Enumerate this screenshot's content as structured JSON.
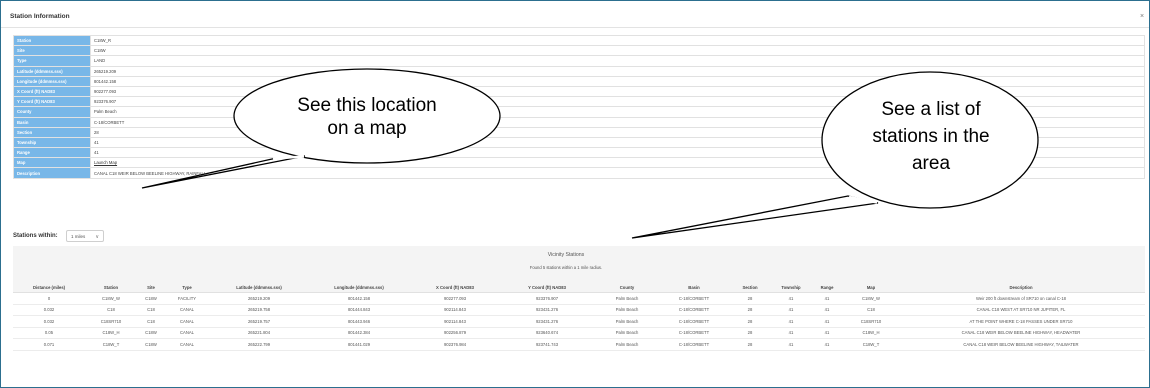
{
  "dialog": {
    "title": "Station Information",
    "close": "×"
  },
  "station_info": [
    {
      "label": "Station",
      "value": "C18W_R"
    },
    {
      "label": "Site",
      "value": "C18W"
    },
    {
      "label": "Type",
      "value": "LAND"
    },
    {
      "label": "Latitude (ddmmss.sss)",
      "value": "265219.209"
    },
    {
      "label": "Longitude (ddmmss.sss)",
      "value": "801442.158"
    },
    {
      "label": "X Coord (ft) NAD83",
      "value": "902277.093"
    },
    {
      "label": "Y Coord (ft) NAD83",
      "value": "923376.907"
    },
    {
      "label": "County",
      "value": "Palm Beach"
    },
    {
      "label": "Basin",
      "value": "C-18/CORBETT"
    },
    {
      "label": "Section",
      "value": "28"
    },
    {
      "label": "Township",
      "value": "41"
    },
    {
      "label": "Range",
      "value": "41"
    },
    {
      "label": "Map",
      "value": "Launch Map"
    },
    {
      "label": "Description",
      "value": "CANAL C18 WEIR BELOW BEELINE HIGHWAY, RAINFALL"
    }
  ],
  "stations_within": {
    "label": "Stations within:",
    "selected": "1 miles"
  },
  "vicinity": {
    "title": "Vicinity Stations",
    "subtitle": "Found 5 stations within a 1 mile radius.",
    "columns": [
      "Distance (miles)",
      "Station",
      "Site",
      "Type",
      "Latitude (ddmmss.sss)",
      "Longitude (ddmmss.sss)",
      "X Coord (ft) NAD83",
      "Y Coord (ft) NAD83",
      "County",
      "Basin",
      "Section",
      "Township",
      "Range",
      "Map",
      "Description"
    ],
    "rows": [
      [
        "0",
        "C18W_W",
        "C18W",
        "FACILITY",
        "265219.209",
        "801442.158",
        "902277.093",
        "923376.907",
        "Palm Beach",
        "C-18/CORBETT",
        "28",
        "41",
        "41",
        "C18W_W",
        "Weir 200 ft downstream of SR710 on canal C-18"
      ],
      [
        "0.032",
        "C18",
        "C18",
        "CANAL",
        "265219.758",
        "801444.843",
        "902114.843",
        "923431.276",
        "Palm Beach",
        "C-18/CORBETT",
        "28",
        "41",
        "41",
        "C18",
        "CANAL C18 WEST AT SR710 NR JUPITER, FL"
      ],
      [
        "0.032",
        "C18SR710",
        "C18",
        "CANAL",
        "265219.757",
        "801443.946",
        "902114.843",
        "923431.276",
        "Palm Beach",
        "C-18/CORBETT",
        "28",
        "41",
        "41",
        "C18SR710",
        "AT THE POINT WHERE C-18 PASSES UNDER SR710"
      ],
      [
        "0.05",
        "C18W_H",
        "C18W",
        "CANAL",
        "265221.804",
        "801442.384",
        "902256.879",
        "923640.674",
        "Palm Beach",
        "C-18/CORBETT",
        "28",
        "41",
        "41",
        "C18W_H",
        "CANAL C18 WEIR BELOW BEELINE HIGHWAY, HEADWATER"
      ],
      [
        "0.071",
        "C18W_T",
        "C18W",
        "CANAL",
        "265222.799",
        "801441.029",
        "902376.984",
        "923741.743",
        "Palm Beach",
        "C-18/CORBETT",
        "28",
        "41",
        "41",
        "C18W_T",
        "CANAL C18 WEIR BELOW BEELINE HIGHWAY, TAILWATER"
      ]
    ]
  },
  "callouts": {
    "map": [
      "See this location",
      "on a map"
    ],
    "list": [
      "See a list of",
      "stations in the",
      "area"
    ]
  }
}
